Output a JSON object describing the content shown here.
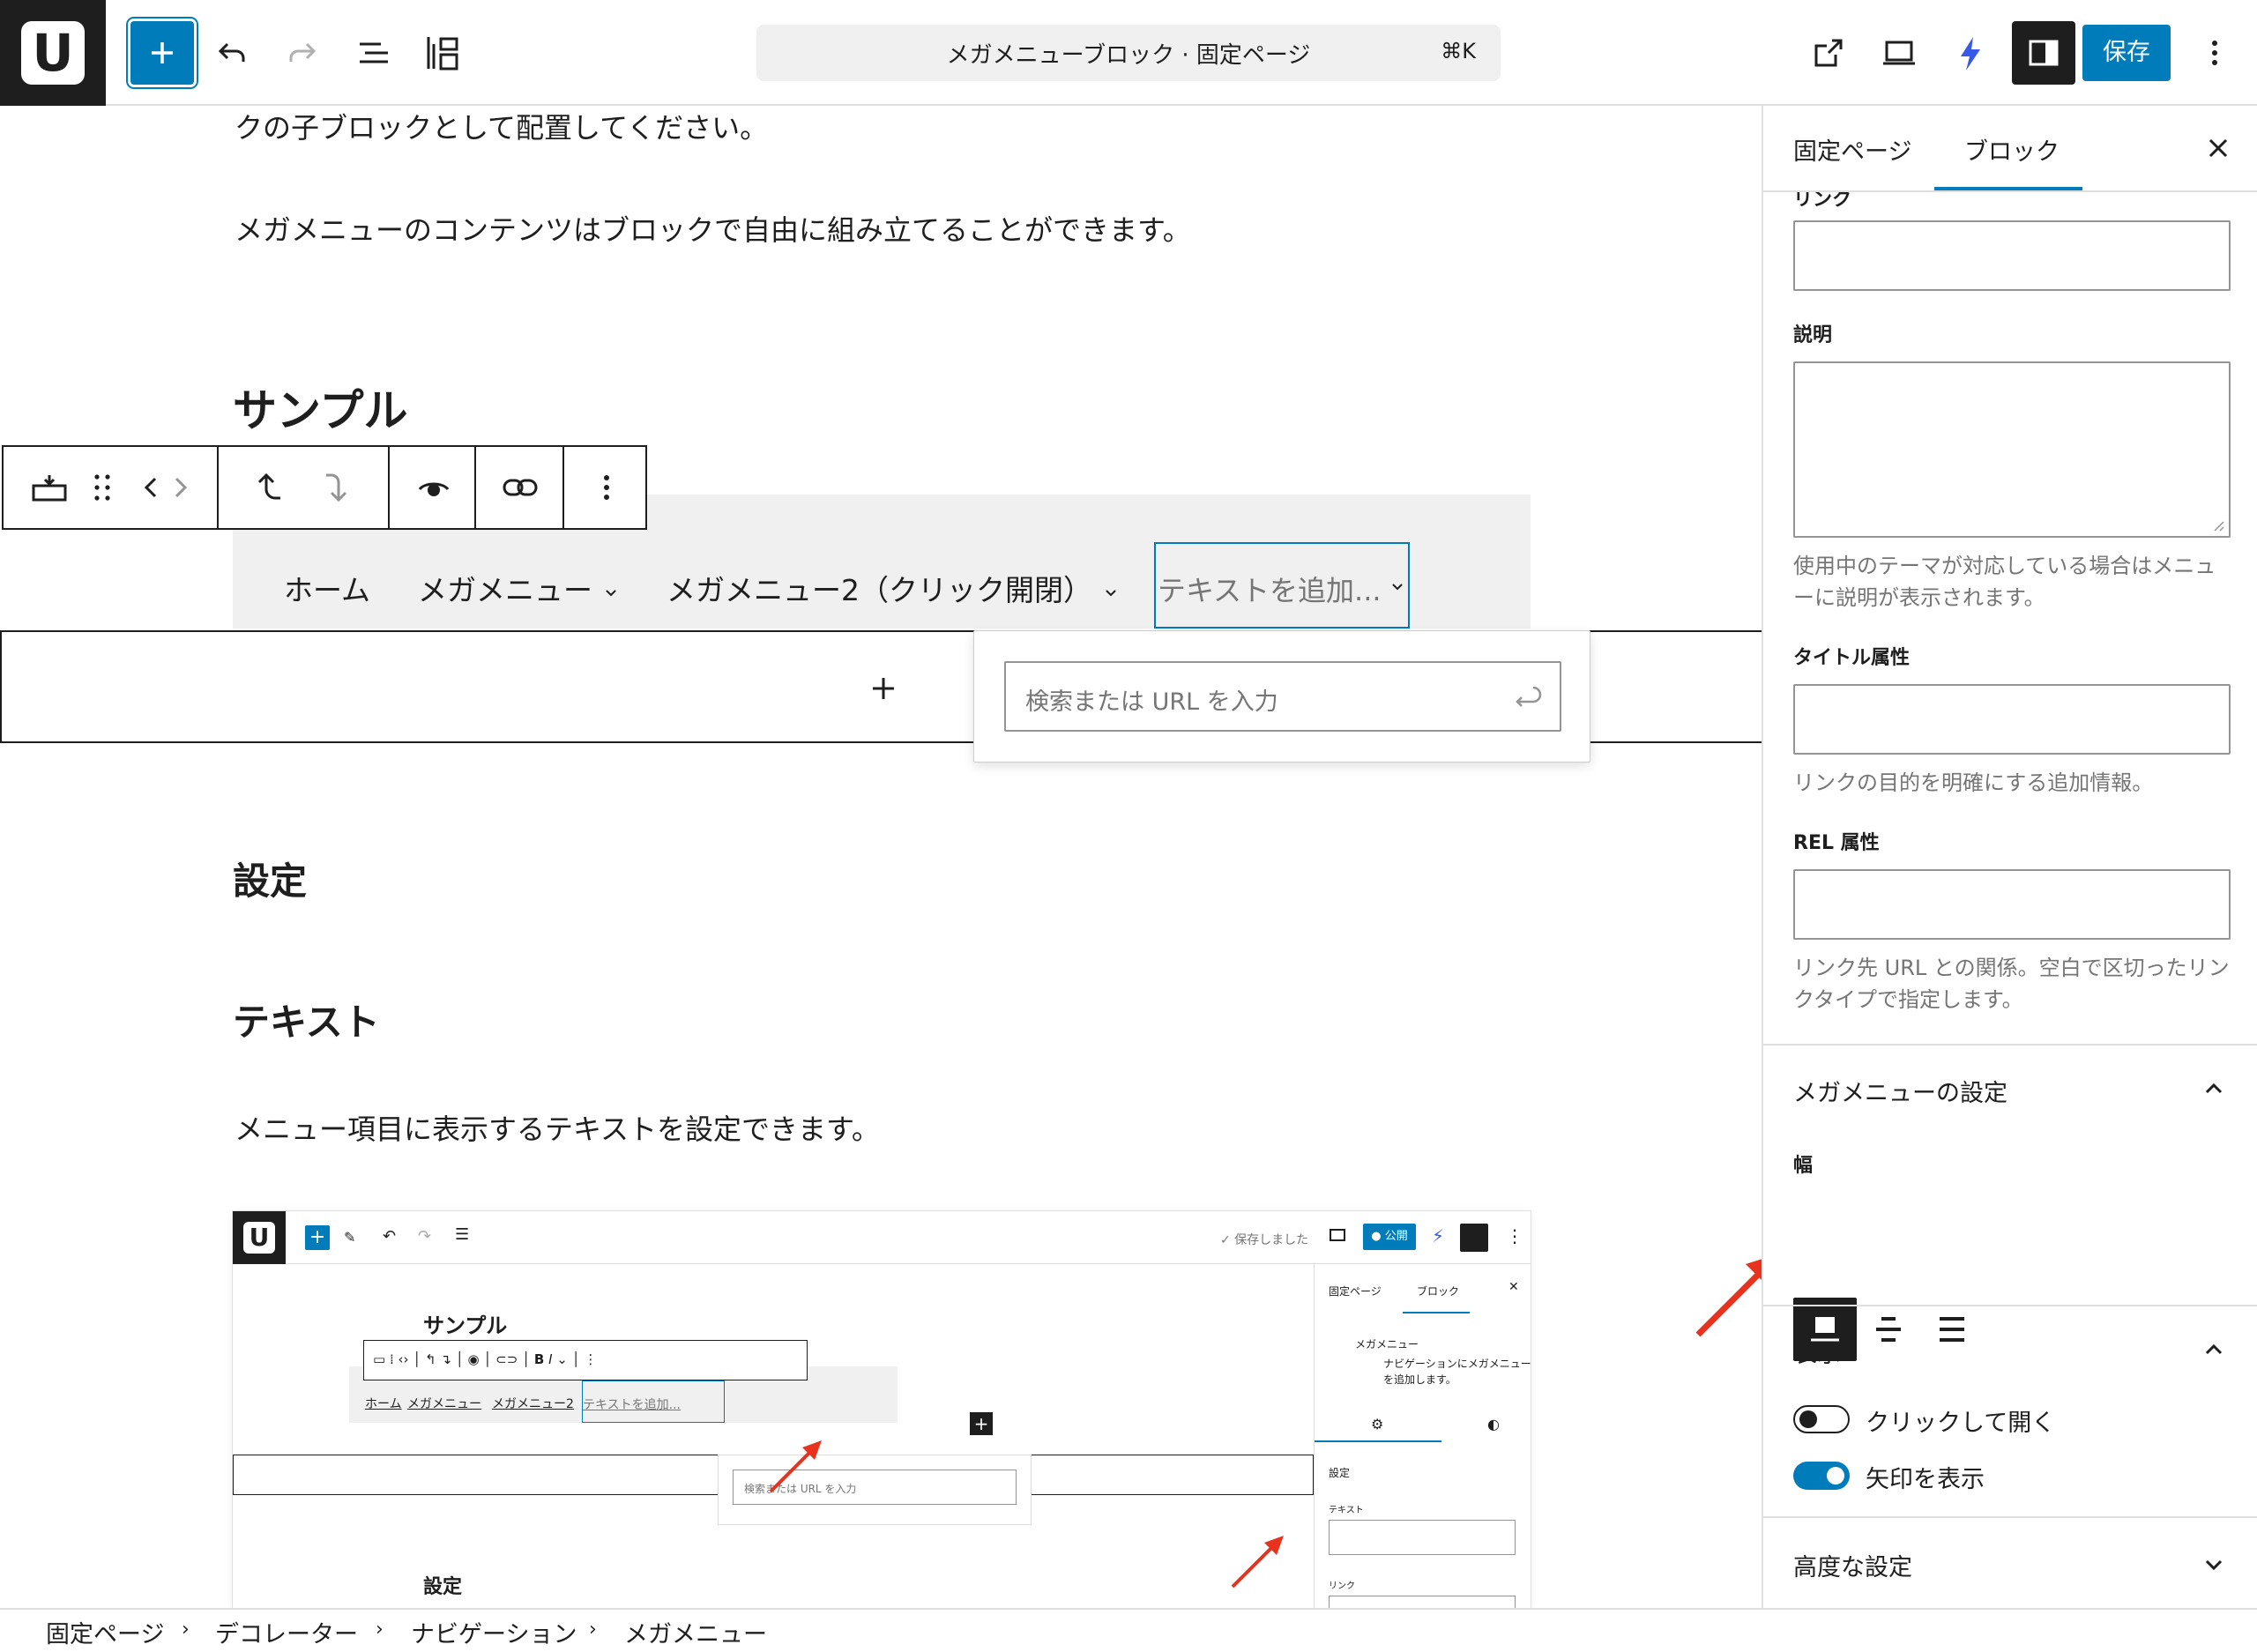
{
  "header": {
    "logo_letter": "U",
    "command_title": "メガメニューブロック · 固定ページ",
    "command_shortcut": "⌘K",
    "save_label": "保存"
  },
  "content": {
    "para1": "クの子ブロックとして配置してください。",
    "para2": "メガメニューのコンテンツはブロックで自由に組み立てることができます。",
    "heading_sample": "サンプル",
    "nav_items": [
      "ホーム",
      "メガメニュー",
      "メガメニュー2（クリック開閉）"
    ],
    "nav_new_item": "テキストを追加...",
    "link_placeholder": "検索または URL を入力",
    "heading_settings": "設定",
    "heading_text": "テキスト",
    "para3": "メニュー項目に表示するテキストを設定できます。"
  },
  "screenshot": {
    "saved": "✓ 保存しました",
    "publish": "● 公開",
    "heading_sample": "サンプル",
    "nav_items": [
      "ホーム",
      "メガメニュー",
      "メガメニュー2"
    ],
    "nav_new_item": "テキストを追加...",
    "link_placeholder": "検索または URL を入力",
    "heading_settings": "設定",
    "tab_page": "固定ページ",
    "tab_block": "ブロック",
    "block_name": "メガメニュー",
    "block_desc_1": "ナビゲーションにメガメニュー",
    "block_desc_2": "を追加します。",
    "panel_settings": "設定",
    "field_text": "テキスト",
    "field_link": "リンク"
  },
  "sidebar": {
    "tab_page": "固定ページ",
    "tab_block": "ブロック",
    "partial_label": "リンク",
    "desc_label": "説明",
    "desc_help": "使用中のテーマが対応している場合はメニューに説明が表示されます。",
    "title_attr_label": "タイトル属性",
    "title_attr_help": "リンクの目的を明確にする追加情報。",
    "rel_label": "REL 属性",
    "rel_help": "リンク先 URL との関係。空白で区切ったリンクタイプで指定します。",
    "mega_panel_title": "メガメニューの設定",
    "width_label": "幅",
    "display_panel_title": "表示",
    "toggle_click_open": "クリックして開く",
    "toggle_show_arrow": "矢印を表示",
    "toggle_click_open_on": false,
    "toggle_show_arrow_on": true,
    "advanced_panel_title": "高度な設定"
  },
  "breadcrumb": [
    "固定ページ",
    "デコレーター",
    "ナビゲーション",
    "メガメニュー"
  ],
  "colors": {
    "accent": "#007cba",
    "annotation_arrow": "#e8321e",
    "dark": "#1e1e1e"
  }
}
